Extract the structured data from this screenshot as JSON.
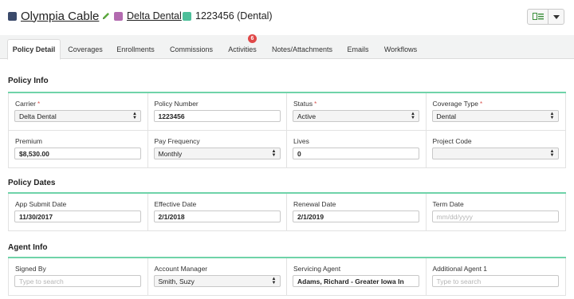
{
  "header": {
    "company": {
      "name": "Olympia Cable",
      "color": "#3b4a6b"
    },
    "carrier": {
      "name": "Delta Dental",
      "color": "#b36bb0"
    },
    "policy": {
      "name": "1223456 (Dental)",
      "color": "#4dbf9a"
    },
    "icons": {
      "edit": "pencil-icon",
      "view": "list-view-icon",
      "menu": "caret-down-icon"
    }
  },
  "tabs": [
    {
      "label": "Policy Detail",
      "active": true
    },
    {
      "label": "Coverages"
    },
    {
      "label": "Enrollments"
    },
    {
      "label": "Commissions"
    },
    {
      "label": "Activities",
      "badge": "6"
    },
    {
      "label": "Notes/Attachments"
    },
    {
      "label": "Emails"
    },
    {
      "label": "Workflows"
    }
  ],
  "policy_info": {
    "title": "Policy Info",
    "carrier": {
      "label": "Carrier",
      "value": "Delta Dental"
    },
    "policy_number": {
      "label": "Policy Number",
      "value": "1223456"
    },
    "status": {
      "label": "Status",
      "value": "Active"
    },
    "coverage_type": {
      "label": "Coverage Type",
      "value": "Dental"
    },
    "premium": {
      "label": "Premium",
      "value": "$8,530.00"
    },
    "pay_frequency": {
      "label": "Pay Frequency",
      "value": "Monthly"
    },
    "lives": {
      "label": "Lives",
      "value": "0"
    },
    "project_code": {
      "label": "Project Code",
      "value": ""
    }
  },
  "policy_dates": {
    "title": "Policy Dates",
    "app_submit": {
      "label": "App Submit Date",
      "value": "11/30/2017"
    },
    "effective": {
      "label": "Effective Date",
      "value": "2/1/2018"
    },
    "renewal": {
      "label": "Renewal Date",
      "value": "2/1/2019"
    },
    "term": {
      "label": "Term Date",
      "placeholder": "mm/dd/yyyy"
    }
  },
  "agent_info": {
    "title": "Agent Info",
    "signed_by": {
      "label": "Signed By",
      "placeholder": "Type to search"
    },
    "account_manager": {
      "label": "Account Manager",
      "value": "Smith, Suzy"
    },
    "servicing_agent": {
      "label": "Servicing Agent",
      "value": "Adams, Richard - Greater Iowa In"
    },
    "additional_agent": {
      "label": "Additional Agent 1",
      "placeholder": "Type to search"
    }
  },
  "colors": {
    "accent": "#6fd3a9",
    "required": "#d9534f",
    "badge": "#e04848"
  }
}
